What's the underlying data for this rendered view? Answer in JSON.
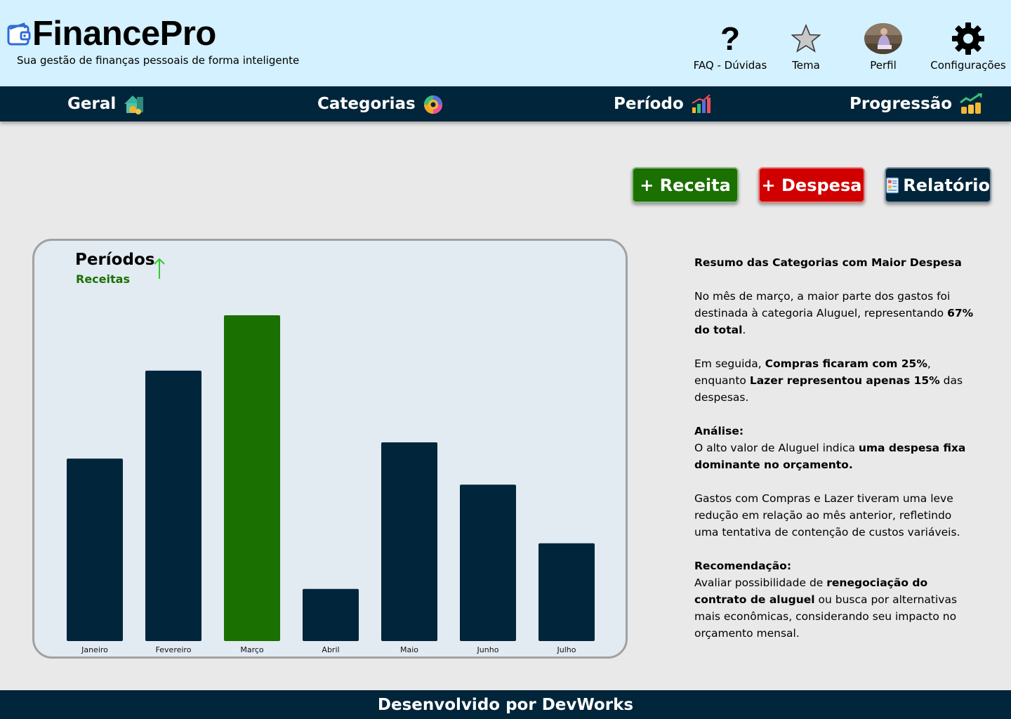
{
  "header": {
    "title": "FinancePro",
    "subtitle": "Sua gestão de finanças pessoais de forma inteligente",
    "items": [
      {
        "label": "FAQ - Dúvidas",
        "icon": "question-icon"
      },
      {
        "label": "Tema",
        "icon": "star-icon"
      },
      {
        "label": "Perfil",
        "icon": "avatar"
      },
      {
        "label": "Configurações",
        "icon": "gear-icon"
      }
    ]
  },
  "nav": {
    "tabs": [
      {
        "label": "Geral",
        "icon": "house-coins-icon"
      },
      {
        "label": "Categorias",
        "icon": "pie-chart-icon"
      },
      {
        "label": "Período",
        "icon": "bar-chart-icon"
      },
      {
        "label": "Progressão",
        "icon": "trend-coins-icon"
      }
    ]
  },
  "actions": {
    "receita": "+ Receita",
    "despesa": "+ Despesa",
    "relatorio": "Relatório"
  },
  "chart_card": {
    "title": "Períodos",
    "subtitle": "Receitas"
  },
  "chart_data": {
    "type": "bar",
    "categories": [
      "Janeiro",
      "Fevereiro",
      "Março",
      "Abril",
      "Maio",
      "Junho",
      "Julho"
    ],
    "values": [
      56,
      83,
      100,
      16,
      61,
      48,
      30
    ],
    "highlight_index": 2,
    "ylim": [
      0,
      100
    ],
    "colors": {
      "default": "#01253a",
      "highlight": "#1a7000"
    }
  },
  "summary": {
    "heading": "Resumo das Categorias com Maior Despesa",
    "p1_a": "No mês de março, a maior parte dos gastos foi destinada à categoria Aluguel, representando ",
    "p1_b": "67% do total",
    "p1_c": ".",
    "p2_a": "Em seguida, ",
    "p2_b": "Compras ficaram com 25%",
    "p2_c": ", enquanto ",
    "p2_d": "Lazer representou apenas 15%",
    "p2_e": " das despesas.",
    "analise_label": "Análise:",
    "analise_a": "O alto valor de Aluguel indica ",
    "analise_b": "uma despesa fixa dominante no orçamento.",
    "p4": "Gastos com Compras e Lazer tiveram uma leve redução em relação ao mês anterior, refletindo uma tentativa de contenção de custos variáveis.",
    "recomendacao_label": "Recomendação:",
    "rec_a": "Avaliar possibilidade de ",
    "rec_b": "renegociação do contrato de aluguel",
    "rec_c": " ou busca por alternativas mais econômicas, considerando seu impacto no orçamento mensal."
  },
  "footer": {
    "text": "Desenvolvido por DevWorks"
  },
  "colors": {
    "header_bg": "#d3f1fe",
    "nav_bg": "#01253a",
    "receita": "#1a7000",
    "despesa": "#d10000",
    "page_bg": "#e9e9e9"
  }
}
